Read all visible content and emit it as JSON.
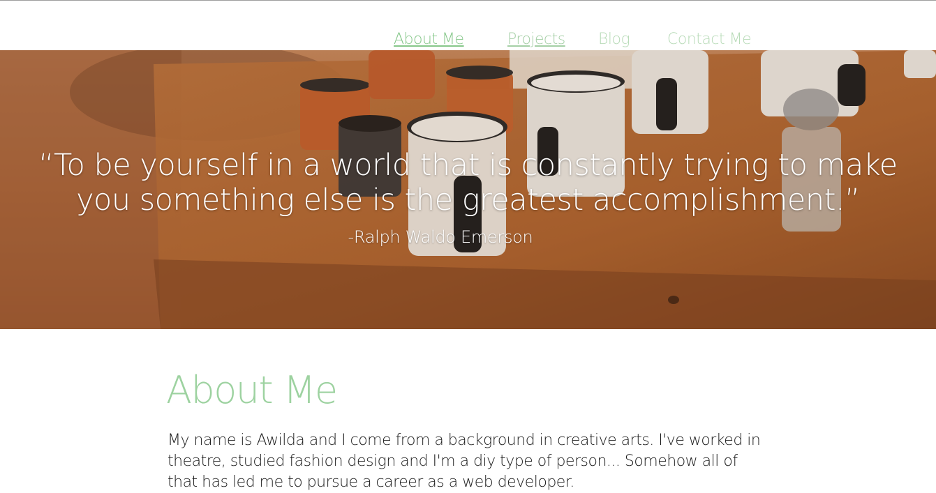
{
  "nav": {
    "items": [
      {
        "label": "About Me",
        "state": "active"
      },
      {
        "label": "Projects",
        "state": "visited"
      },
      {
        "label": "Blog",
        "state": "plain"
      },
      {
        "label": "Contact Me",
        "state": "plain"
      }
    ]
  },
  "hero": {
    "quote": "“To be yourself in a world that is constantly trying to make you something else is the greatest accomplishment.”",
    "author": "-Ralph Waldo Emerson"
  },
  "about": {
    "title": "About Me",
    "text": "My name is Awilda and I come from a background in creative arts. I've worked in theatre, studied fashion design and I'm a diy type of person... Somehow all of that has led me to pursue a career as a web developer."
  },
  "colors": {
    "accent_green": "#9dd2a0",
    "nav_active": "#86c78a",
    "text": "#1c1c1c",
    "hero_wood": "#b66d3e"
  }
}
